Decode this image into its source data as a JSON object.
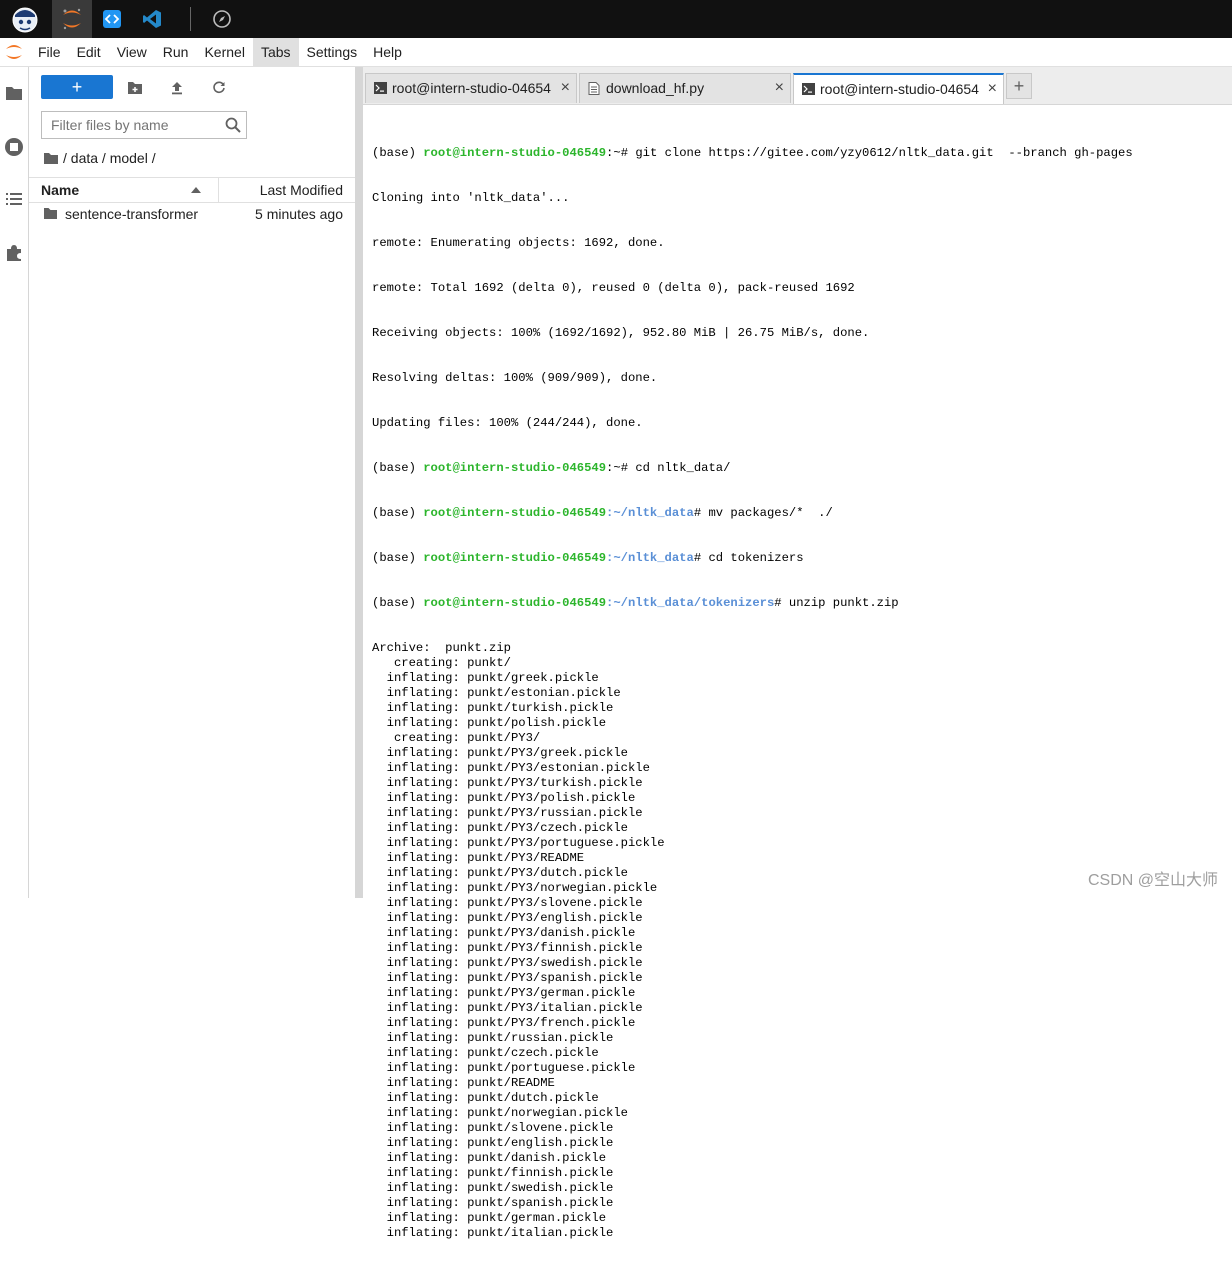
{
  "menu": {
    "items": [
      "File",
      "Edit",
      "View",
      "Run",
      "Kernel",
      "Tabs",
      "Settings",
      "Help"
    ],
    "active": "Tabs"
  },
  "file_browser": {
    "new_button_label": "+",
    "filter_placeholder": "Filter files by name",
    "breadcrumb": "/ data / model /",
    "columns": {
      "name": "Name",
      "modified": "Last Modified"
    },
    "files": [
      {
        "name": "sentence-transformer",
        "modified": "5 minutes ago",
        "type": "folder"
      }
    ]
  },
  "tabs": [
    {
      "label": "root@intern-studio-04654",
      "icon": "terminal-icon",
      "active": false
    },
    {
      "label": "download_hf.py",
      "icon": "file-icon",
      "active": false
    },
    {
      "label": "root@intern-studio-04654",
      "icon": "terminal-icon",
      "active": true
    }
  ],
  "tab_close": "×",
  "tab_add": "+",
  "terminal": {
    "prompt_prefix": "(base) ",
    "host": "root@intern-studio-046549",
    "commands": [
      {
        "path": ":~",
        "cmd": "# git clone https://gitee.com/yzy0612/nltk_data.git  --branch gh-pages"
      },
      {
        "path": ":~",
        "cmd": "# cd nltk_data/"
      },
      {
        "path": ":~/nltk_data",
        "cmd": "# mv packages/*  ./"
      },
      {
        "path": ":~/nltk_data",
        "cmd": "# cd tokenizers"
      },
      {
        "path": ":~/nltk_data/tokenizers",
        "cmd": "# unzip punkt.zip"
      }
    ],
    "clone_output": [
      "Cloning into 'nltk_data'...",
      "remote: Enumerating objects: 1692, done.",
      "remote: Total 1692 (delta 0), reused 0 (delta 0), pack-reused 1692",
      "Receiving objects: 100% (1692/1692), 952.80 MiB | 26.75 MiB/s, done.",
      "Resolving deltas: 100% (909/909), done.",
      "Updating files: 100% (244/244), done."
    ],
    "unzip_output": [
      "Archive:  punkt.zip",
      "   creating: punkt/",
      "  inflating: punkt/greek.pickle",
      "  inflating: punkt/estonian.pickle",
      "  inflating: punkt/turkish.pickle",
      "  inflating: punkt/polish.pickle",
      "   creating: punkt/PY3/",
      "  inflating: punkt/PY3/greek.pickle",
      "  inflating: punkt/PY3/estonian.pickle",
      "  inflating: punkt/PY3/turkish.pickle",
      "  inflating: punkt/PY3/polish.pickle",
      "  inflating: punkt/PY3/russian.pickle",
      "  inflating: punkt/PY3/czech.pickle",
      "  inflating: punkt/PY3/portuguese.pickle",
      "  inflating: punkt/PY3/README",
      "  inflating: punkt/PY3/dutch.pickle",
      "  inflating: punkt/PY3/norwegian.pickle",
      "  inflating: punkt/PY3/slovene.pickle",
      "  inflating: punkt/PY3/english.pickle",
      "  inflating: punkt/PY3/danish.pickle",
      "  inflating: punkt/PY3/finnish.pickle",
      "  inflating: punkt/PY3/swedish.pickle",
      "  inflating: punkt/PY3/spanish.pickle",
      "  inflating: punkt/PY3/german.pickle",
      "  inflating: punkt/PY3/italian.pickle",
      "  inflating: punkt/PY3/french.pickle",
      "  inflating: punkt/russian.pickle",
      "  inflating: punkt/czech.pickle",
      "  inflating: punkt/portuguese.pickle",
      "  inflating: punkt/README",
      "  inflating: punkt/dutch.pickle",
      "  inflating: punkt/norwegian.pickle",
      "  inflating: punkt/slovene.pickle",
      "  inflating: punkt/english.pickle",
      "  inflating: punkt/danish.pickle",
      "  inflating: punkt/finnish.pickle",
      "  inflating: punkt/swedish.pickle",
      "  inflating: punkt/spanish.pickle",
      "  inflating: punkt/german.pickle",
      "  inflating: punkt/italian.pickle"
    ]
  },
  "watermark": "CSDN @空山大师",
  "colors": {
    "accent": "#1976d2",
    "prompt_host": "#2cb52c",
    "prompt_path": "#5a8fd6",
    "jupyter_orange": "#f37726",
    "vscode_blue": "#2489ca"
  }
}
